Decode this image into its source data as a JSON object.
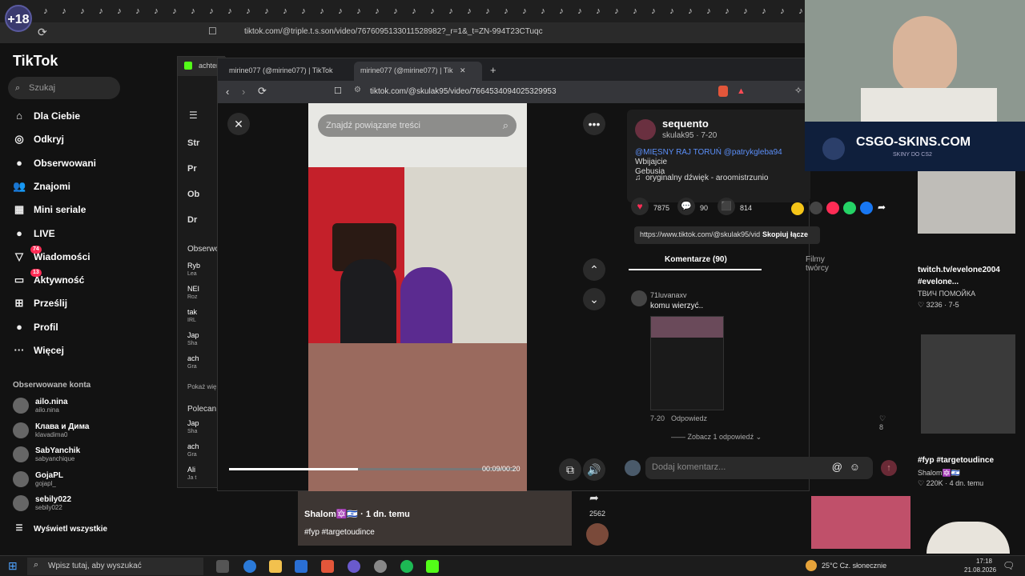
{
  "badge": "+18",
  "top_browser": {
    "url": "tiktok.com/@triple.t.s.son/video/7676095133011528982?_r=1&_t=ZN-994T23CTuqc"
  },
  "left_nav": {
    "logo": "TikTok",
    "search_placeholder": "Szukaj",
    "items": [
      {
        "label": "Dla Ciebie",
        "icon": "home-icon"
      },
      {
        "label": "Odkryj",
        "icon": "compass-icon"
      },
      {
        "label": "Obserwowani",
        "icon": "following-icon"
      },
      {
        "label": "Znajomi",
        "icon": "friends-icon"
      },
      {
        "label": "Mini seriale",
        "icon": "series-icon"
      },
      {
        "label": "LIVE",
        "icon": "live-icon"
      },
      {
        "label": "Wiadomości",
        "icon": "messages-icon",
        "count": "74"
      },
      {
        "label": "Aktywność",
        "icon": "activity-icon",
        "count": "13"
      },
      {
        "label": "Prześlij",
        "icon": "upload-icon"
      },
      {
        "label": "Profil",
        "icon": "profile-icon"
      },
      {
        "label": "Więcej",
        "icon": "more-icon"
      }
    ],
    "followed_title": "Obserwowane konta",
    "followed": [
      {
        "name": "ailo.nina",
        "handle": "ailo.nina"
      },
      {
        "name": "Клава и Дима",
        "handle": "klavadima0"
      },
      {
        "name": "SabYanchik",
        "handle": "sabyanchique"
      },
      {
        "name": "GojaPL",
        "handle": "gojapl_"
      },
      {
        "name": "sebily022",
        "handle": "sebily022"
      }
    ],
    "see_all": "Wyświetl wszystkie"
  },
  "mid_window": {
    "tab": "achter",
    "items": [
      "Str",
      "Pr",
      "Ob",
      "Dr"
    ],
    "section1": "Obserwo",
    "accounts1": [
      {
        "n": "Ryb",
        "h": "Lea"
      },
      {
        "n": "NEI",
        "h": "Roz"
      },
      {
        "n": "tak",
        "h": "IRL"
      },
      {
        "n": "Jap",
        "h": "Sha"
      },
      {
        "n": "ach",
        "h": "Gra"
      }
    ],
    "show_more": "Pokaż wię",
    "section2": "Polecan",
    "accounts2": [
      {
        "n": "Jap",
        "h": "Sha"
      },
      {
        "n": "ach",
        "h": "Gra"
      },
      {
        "n": "Ali",
        "h": "Ja t"
      }
    ]
  },
  "main_window": {
    "tabs": [
      "mirine077 (@mirine077) | TikTok",
      "mirine077 (@mirine077) | Tik"
    ],
    "url": "tiktok.com/@skulak95/video/7664534094025329953",
    "video": {
      "search_placeholder": "Znajdź powiązane treści",
      "time": "00:09/00:20",
      "progress": 0.45
    },
    "post": {
      "author": "sequento",
      "meta": "skulak95 · 7-20",
      "caption_mentions": "@MIĘSNY RAJ TORUŃ @patrykgleba94",
      "caption_text": "Wbijajcie",
      "caption_tail": "Gebusia",
      "sound": "oryginalny dźwięk - aroomistrzunio",
      "likes": "7875",
      "comments": "90",
      "saves": "814",
      "share_url": "https://www.tiktok.com/@skulak95/video/766453...",
      "copy_label": "Skopiuj łącze",
      "tab_comments": "Komentarze (90)",
      "tab_creator": "Filmy twórcy"
    },
    "comment": {
      "user": "71luvanaxv",
      "text": "komu wierzyć..",
      "date": "7-20",
      "reply": "Odpowiedz",
      "likes": "8",
      "see_replies": "Zobacz 1 odpowiedź"
    },
    "add_comment_placeholder": "Dodaj komentarz..."
  },
  "bottom_video": {
    "title": "Shalom🔯🇮🇱 · 1 dn. temu",
    "tags": "#fyp #targetoudince",
    "count": "2562"
  },
  "right_column": {
    "ad_title": "CSGO-SKINS.COM",
    "ad_sub": "SKINY DO CS2",
    "card1": {
      "title": "twitch.tv/evelone2004 #evelone...",
      "sub": "ТВИЧ ПОМОЙКА",
      "stats": "3236 · 7-5"
    },
    "card2": {
      "title": "#fyp #targetoudince",
      "sub": "Shalom🔯🇮🇱",
      "stats": "220K · 4 dn. temu"
    }
  },
  "taskbar": {
    "search": "Wpisz tutaj, aby wyszukać",
    "weather": "25°C  Cz. słonecznie",
    "time": "17:18",
    "date": "21.08.2026"
  }
}
